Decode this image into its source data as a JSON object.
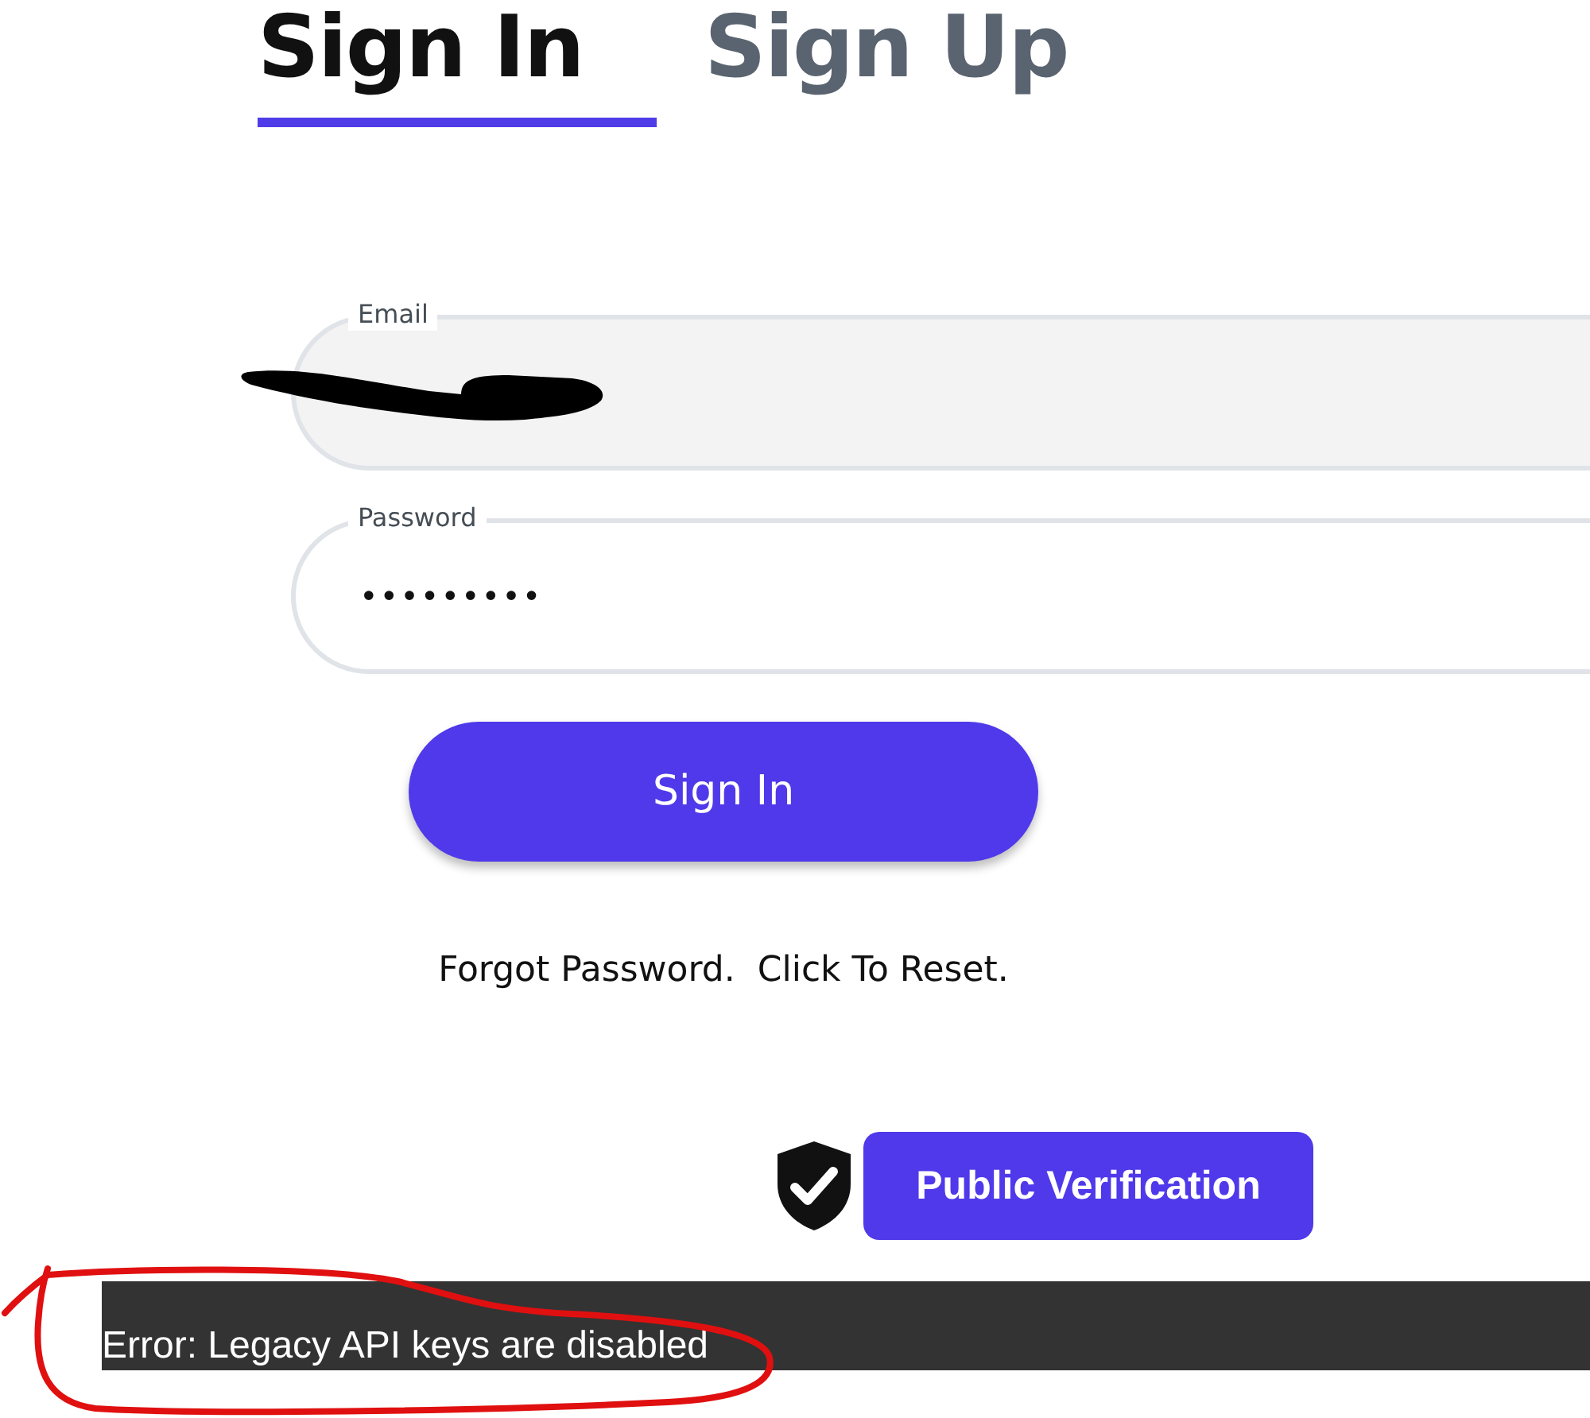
{
  "tabs": [
    {
      "label": "Sign In",
      "selected": true
    },
    {
      "label": "Sign Up",
      "selected": false
    }
  ],
  "fields": [
    {
      "kind": "email",
      "label": "Email"
    },
    {
      "kind": "password",
      "label": "Password",
      "value": "•••••••••"
    }
  ],
  "sign_in_button": "Sign In",
  "forgot_password": "Forgot Password.  Click To Reset.",
  "public_verification_button": "Public Verification",
  "error_message": "Error: Legacy API keys are disabled"
}
